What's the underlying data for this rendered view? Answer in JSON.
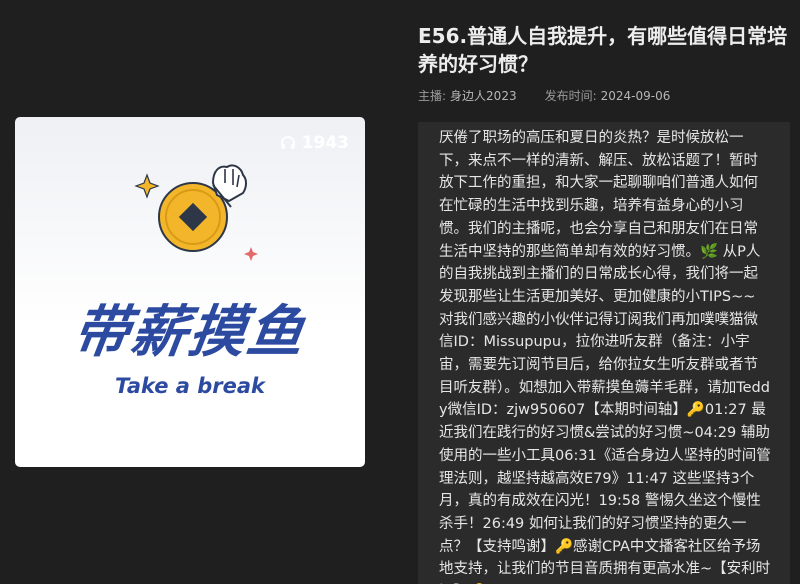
{
  "episode": {
    "title": "E56.普通人自我提升，有哪些值得日常培养的好习惯？",
    "host_label": "主播:",
    "host_value": "身边人2023",
    "date_label": "发布时间:",
    "date_value": "2024-09-06"
  },
  "cover": {
    "play_count": "1943",
    "logo_text": "带薪摸鱼",
    "tagline": "Take a break",
    "colors": {
      "brand_blue": "#2b4aa0",
      "coin_gold": "#f3b62b",
      "sparkle_orange": "#f3b62b",
      "sparkle_red": "#e36a6a"
    },
    "icons": [
      "headphones-icon",
      "coin-icon",
      "hand-icon",
      "sparkle-icon"
    ]
  },
  "description": "厌倦了职场的高压和夏日的炎热？是时候放松一下，来点不一样的清新、解压、放松话题了！暂时放下工作的重担，和大家一起聊聊咱们普通人如何在忙碌的生活中找到乐趣，培养有益身心的小习惯。我们的主播呢，也会分享自己和朋友们在日常生活中坚持的那些简单却有效的好习惯。🌿 从P人的自我挑战到主播们的日常成长心得，我们将一起发现那些让生活更加美好、更加健康的小TIPS~~\n对我们感兴趣的小伙伴记得订阅我们再加噗噗猫微信ID：Missupupu，拉你进听友群（备注：小宇宙，需要先订阅节目后，给你拉女生听友群或者节目听友群）。如想加入带薪摸鱼薅羊毛群，请加Teddy微信ID：zjw950607【本期时间轴】🔑01:27 最近我们在践行的好习惯&尝试的好习惯~04:29 辅助使用的一些小工具06:31《适合身边人坚持的时间管理法则，越坚持越高效E79》11:47 这些坚持3个月，真的有成效在闪光！19:58 警惕久坐这个慢性杀手！26:49 如何让我们的好习惯坚持的更久一点？【支持鸣谢】🔑感谢CPA中文播客社区给予场地支持，让我们的节目音质拥有更高水准~【安利时间】🔑"
}
